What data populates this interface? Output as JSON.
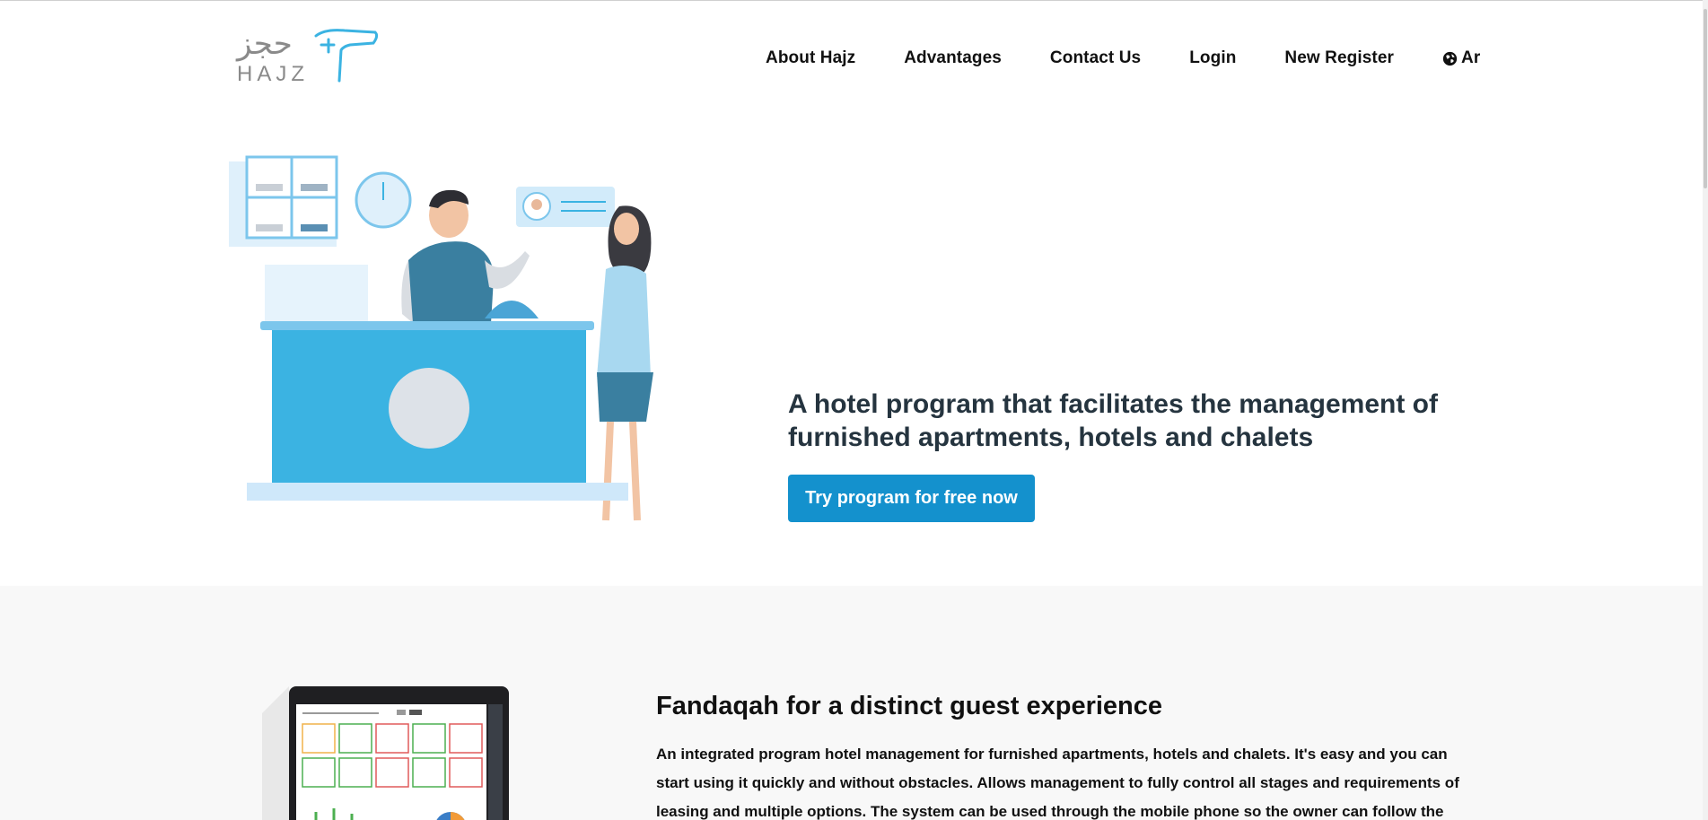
{
  "brand": {
    "arabic_logo": "حجز",
    "latin_logo": "HAJZ"
  },
  "nav": {
    "items": [
      {
        "label": "About Hajz"
      },
      {
        "label": "Advantages"
      },
      {
        "label": "Contact Us"
      },
      {
        "label": "Login"
      },
      {
        "label": "New Register"
      }
    ],
    "lang_label": "Ar",
    "lang_icon": "globe-icon"
  },
  "hero": {
    "title": "A hotel program that facilitates the management of furnished apartments, hotels and chalets",
    "cta_label": "Try program for free now",
    "slides_total": 2,
    "active_slide": 1
  },
  "features": {
    "title": "Fandaqah for a distinct guest experience",
    "text": "An integrated program hotel management for furnished apartments, hotels and chalets. It's easy and you can start using it quickly and without obstacles. Allows management to fully control all stages and requirements of leasing and multiple options. The system can be used through the mobile phone so the owner can follow the facility with"
  },
  "colors": {
    "accent": "#1491cd",
    "heading": "#25343f",
    "section_bg": "#f8f8f8",
    "illustration_blue": "#3bb3e2"
  }
}
